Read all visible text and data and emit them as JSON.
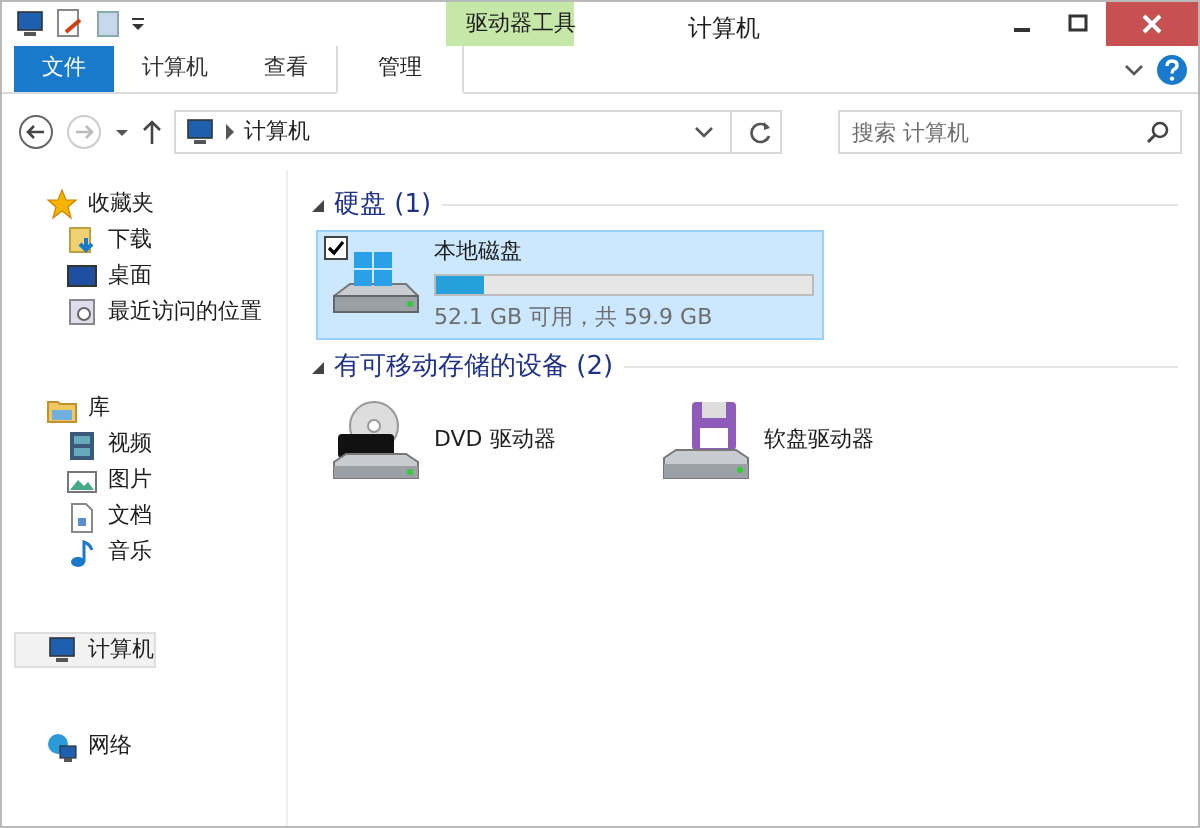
{
  "window": {
    "title": "计算机"
  },
  "ribbon": {
    "context_group": "驱动器工具",
    "tabs": [
      {
        "label": "文件",
        "kind": "file",
        "selected": false
      },
      {
        "label": "计算机",
        "kind": "tab",
        "selected": false
      },
      {
        "label": "查看",
        "kind": "tab",
        "selected": false
      },
      {
        "label": "管理",
        "kind": "context",
        "selected": true
      }
    ]
  },
  "address_bar": {
    "path": "计算机"
  },
  "search": {
    "placeholder": "搜索 计算机"
  },
  "sidebar": {
    "groups": [
      {
        "label": "收藏夹",
        "selected": false,
        "children": [
          {
            "label": "下载",
            "selected": false
          },
          {
            "label": "桌面",
            "selected": false
          },
          {
            "label": "最近访问的位置",
            "selected": false
          }
        ]
      },
      {
        "label": "库",
        "selected": false,
        "children": [
          {
            "label": "视频",
            "selected": false
          },
          {
            "label": "图片",
            "selected": false
          },
          {
            "label": "文档",
            "selected": false
          },
          {
            "label": "音乐",
            "selected": false
          }
        ]
      },
      {
        "label": "计算机",
        "selected": true
      },
      {
        "label": "网络",
        "selected": false
      }
    ]
  },
  "sections": [
    {
      "title": "硬盘 (1)",
      "items": [
        {
          "kind": "disk",
          "name": "本地磁盘",
          "selected": true,
          "checked": true,
          "level": 0.13,
          "info": "52.1 GB 可用，共 59.9 GB"
        }
      ]
    },
    {
      "title": "有可移动存储的设备 (2)",
      "items": [
        {
          "kind": "dvd",
          "name": "DVD 驱动器",
          "selected": false
        },
        {
          "kind": "floppy",
          "name": "软盘驱动器",
          "selected": false
        }
      ]
    }
  ]
}
